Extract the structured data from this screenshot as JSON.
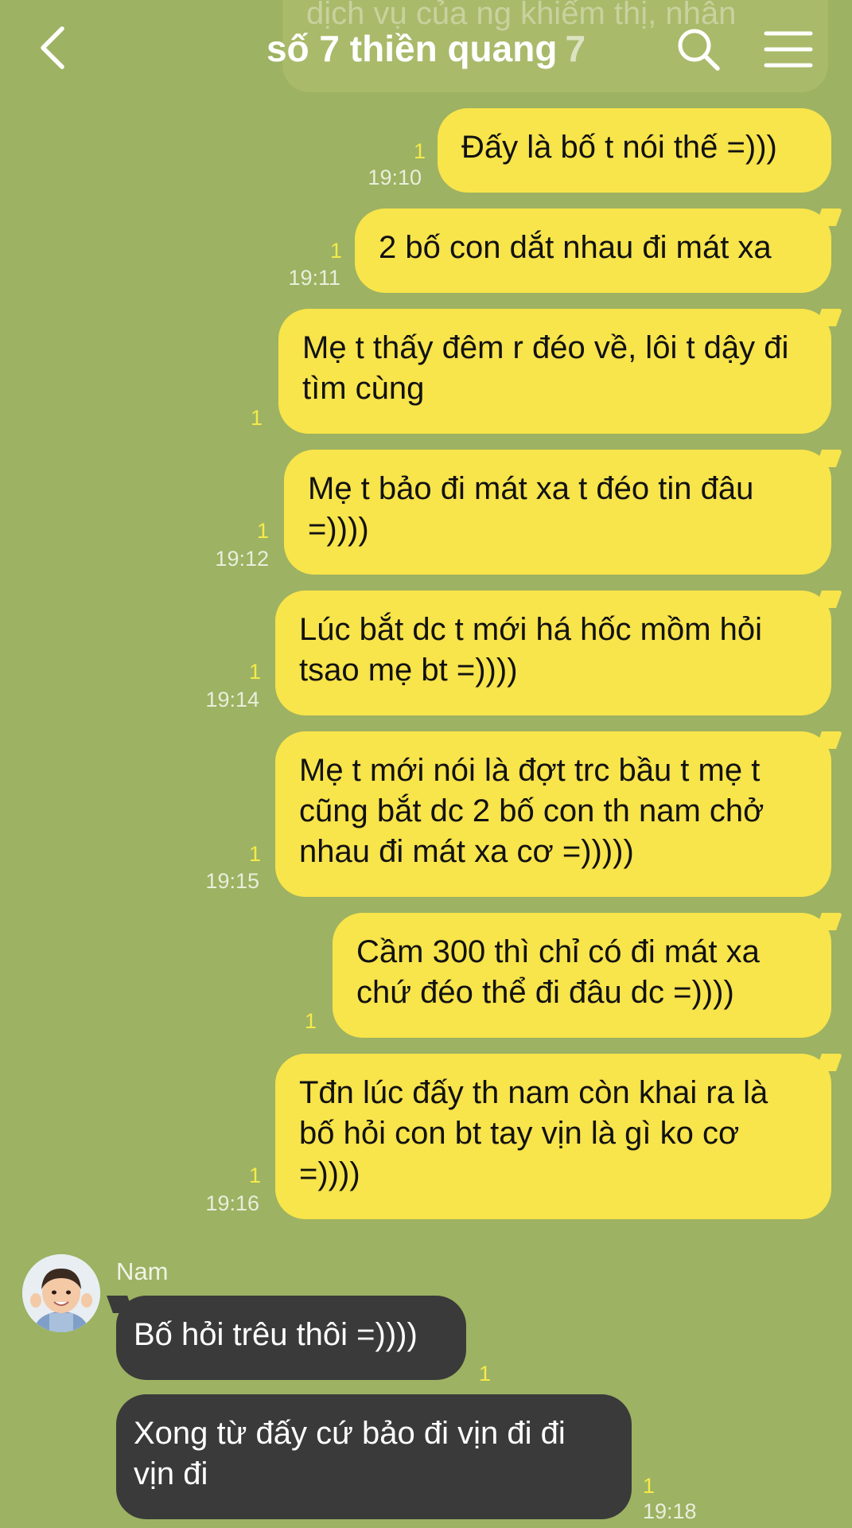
{
  "header": {
    "title": "số 7 thiền quang",
    "member_count": "7",
    "ghost_text": "dịch vụ của ng khiếm thị, nhân",
    "icons": {
      "back": "chevron-left-icon",
      "search": "search-icon",
      "menu": "hamburger-menu-icon"
    }
  },
  "colors": {
    "background": "#9db262",
    "my_bubble": "#f8e44b",
    "their_bubble": "#3a3a3a",
    "read_count": "#f5ea4a"
  },
  "messages": [
    {
      "text": "Đấy là bố t nói thế =)))",
      "read": "1",
      "time": "19:10"
    },
    {
      "text": "2 bố con dắt nhau đi mát xa",
      "read": "1",
      "time": "19:11"
    },
    {
      "text": "Mẹ t thấy đêm r đéo về, lôi t dậy đi tìm cùng",
      "read": "1",
      "time": ""
    },
    {
      "text": "Mẹ t bảo đi mát xa t đéo tin đâu =))))",
      "read": "1",
      "time": "19:12"
    },
    {
      "text": "Lúc bắt dc t mới há hốc mồm hỏi tsao mẹ bt =))))",
      "read": "1",
      "time": "19:14"
    },
    {
      "text": "Mẹ t mới nói là đợt trc bầu t mẹ t cũng bắt dc 2 bố con th nam chở nhau đi mát xa cơ =)))))",
      "read": "1",
      "time": "19:15"
    },
    {
      "text": "Cầm 300 thì chỉ có đi mát xa chứ đéo thể đi đâu dc =))))",
      "read": "1",
      "time": ""
    },
    {
      "text": "Tđn lúc đấy th nam còn khai ra là bố hỏi con bt tay vịn là gì ko cơ =))))",
      "read": "1",
      "time": "19:16"
    }
  ],
  "incoming": {
    "sender": "Nam",
    "avatar": "avatar-child-photo",
    "messages": [
      {
        "text": "Bố hỏi trêu thôi =))))",
        "read": "1",
        "time": ""
      },
      {
        "text": "Xong từ đấy cứ bảo đi vịn đi đi vịn đi",
        "read": "1",
        "time": "19:18"
      }
    ]
  }
}
